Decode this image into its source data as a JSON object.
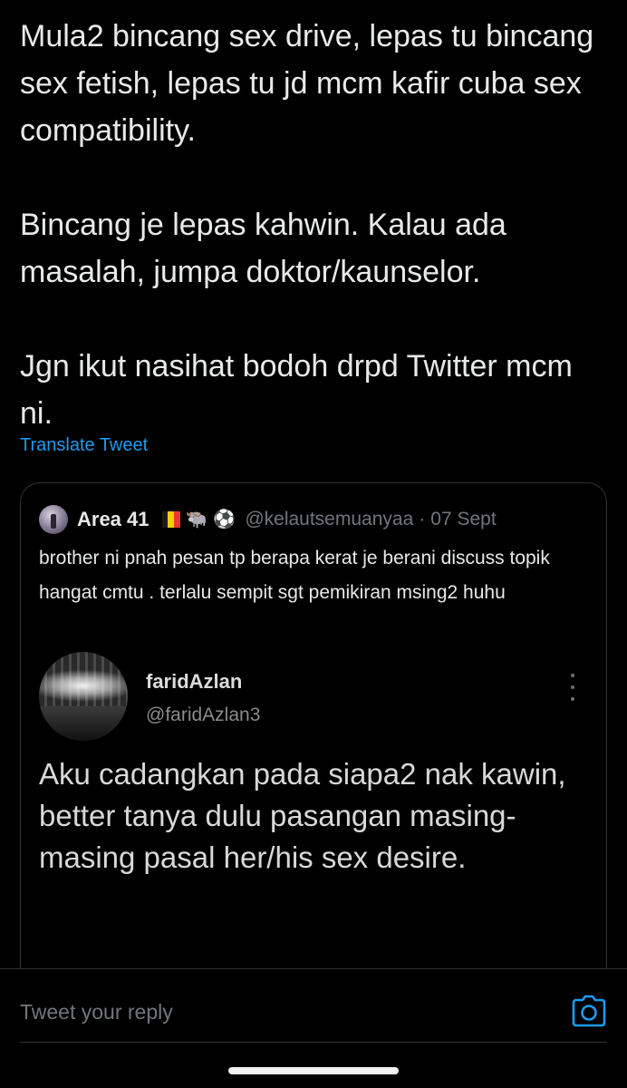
{
  "tweet": {
    "paragraphs": [
      "Mula2 bincang sex drive, lepas tu bincang sex fetish, lepas tu jd mcm kafir cuba sex compatibility.",
      "Bincang je lepas kahwin. Kalau ada masalah, jumpa doktor/kaunselor.",
      "Jgn ikut nasihat bodoh drpd Twitter mcm ni."
    ],
    "translate_label": "Translate Tweet"
  },
  "quote": {
    "name": "Area 41",
    "emojis": [
      "🐃",
      "⚽"
    ],
    "flag_colors": [
      "#1a1a1a",
      "#f5d000",
      "#e53935"
    ],
    "handle": "@kelautsemuanyaa",
    "separator": "·",
    "date": "07 Sept",
    "text": "brother ni pnah pesan tp berapa kerat je berani discuss topik hangat cmtu . terlalu sempit sgt pemikiran msing2 huhu",
    "embedded": {
      "name": "faridAzlan",
      "handle": "@faridAzlan3",
      "text": "Aku cadangkan pada siapa2 nak kawin, better tanya dulu pasangan masing-masing pasal her/his sex desire."
    }
  },
  "reply": {
    "placeholder": "Tweet your reply",
    "camera_icon": "camera-icon"
  },
  "colors": {
    "background": "#000000",
    "text": "#e7e9ea",
    "secondary": "#71767b",
    "link": "#1d9bf0",
    "border": "#2f3336"
  }
}
